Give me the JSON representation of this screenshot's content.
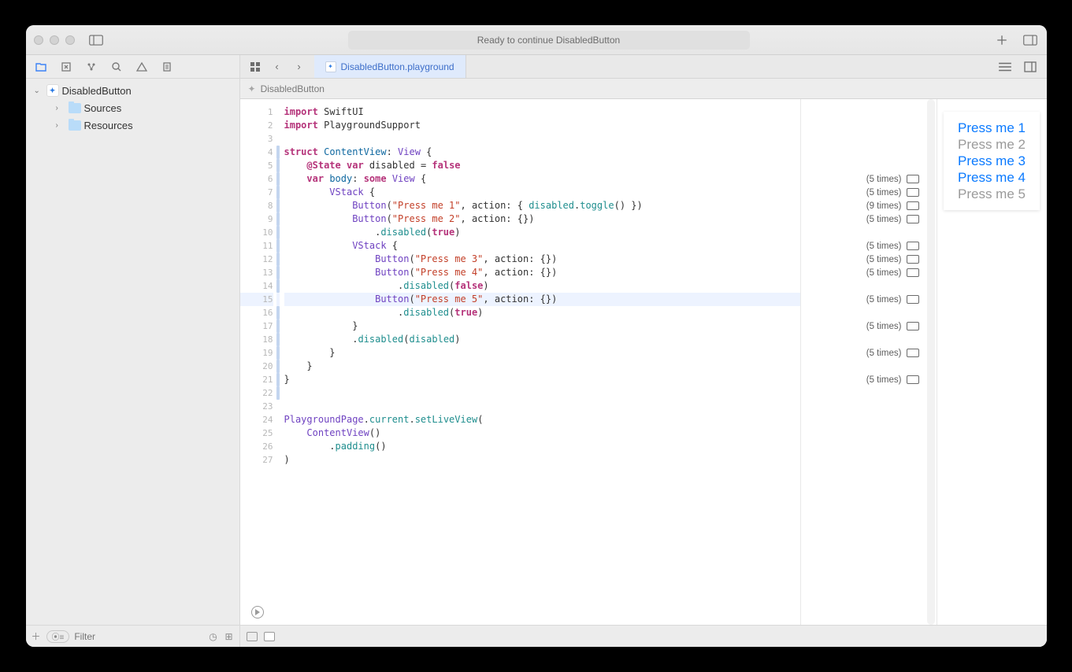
{
  "title": "Ready to continue DisabledButton",
  "sidebar": {
    "project": "DisabledButton",
    "children": [
      {
        "label": "Sources"
      },
      {
        "label": "Resources"
      }
    ],
    "filter_placeholder": "Filter"
  },
  "tab": {
    "label": "DisabledButton.playground"
  },
  "jumpbar": {
    "crumb": "DisabledButton"
  },
  "code": {
    "line_count": 27,
    "highlighted_line": 15,
    "change_bars": [
      4,
      5,
      6,
      7,
      8,
      9,
      10,
      11,
      12,
      13,
      14,
      15,
      16,
      17,
      18,
      19,
      20,
      21,
      22
    ],
    "tokens": {
      "import": "import",
      "SwiftUI": "SwiftUI",
      "PlaygroundSupport": "PlaygroundSupport",
      "struct": "struct",
      "ContentView": "ContentView",
      "View": "View",
      "State": "@State",
      "var": "var",
      "disabled_id": "disabled",
      "false": "false",
      "true": "true",
      "body": "body",
      "some": "some",
      "VStack": "VStack",
      "Button": "Button",
      "press1": "\"Press me 1\"",
      "press2": "\"Press me 2\"",
      "press3": "\"Press me 3\"",
      "press4": "\"Press me 4\"",
      "press5": "\"Press me 5\"",
      "action": "action",
      "toggle": "toggle",
      "disabled_fn": "disabled",
      "current": "current",
      "setLiveView": "setLiveView",
      "PlaygroundPage": "PlaygroundPage",
      "padding": "padding"
    }
  },
  "results": [
    {
      "line": 6,
      "text": "(5 times)"
    },
    {
      "line": 7,
      "text": "(5 times)"
    },
    {
      "line": 8,
      "text": "(9 times)"
    },
    {
      "line": 9,
      "text": "(5 times)"
    },
    {
      "line": 11,
      "text": "(5 times)"
    },
    {
      "line": 12,
      "text": "(5 times)"
    },
    {
      "line": 13,
      "text": "(5 times)"
    },
    {
      "line": 15,
      "text": "(5 times)"
    },
    {
      "line": 17,
      "text": "(5 times)"
    },
    {
      "line": 19,
      "text": "(5 times)"
    },
    {
      "line": 21,
      "text": "(5 times)"
    }
  ],
  "preview": {
    "buttons": [
      {
        "label": "Press me 1",
        "enabled": true
      },
      {
        "label": "Press me 2",
        "enabled": false
      },
      {
        "label": "Press me 3",
        "enabled": true
      },
      {
        "label": "Press me 4",
        "enabled": true
      },
      {
        "label": "Press me 5",
        "enabled": false
      }
    ]
  }
}
